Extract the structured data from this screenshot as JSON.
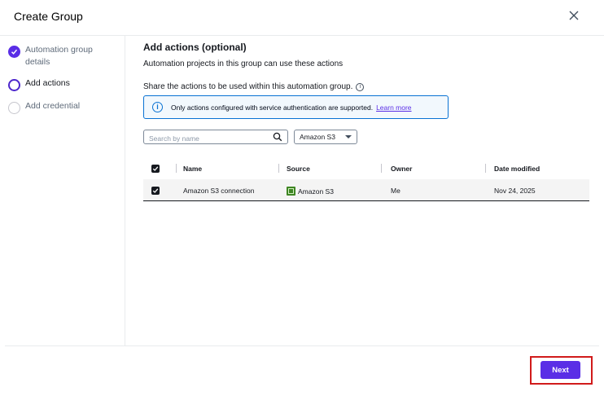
{
  "modal": {
    "title": "Create Group"
  },
  "steps": [
    {
      "label": "Automation group details",
      "state": "completed"
    },
    {
      "label": "Add actions",
      "state": "current"
    },
    {
      "label": "Add credential",
      "state": "pending"
    }
  ],
  "main": {
    "heading": "Add actions (optional)",
    "description": "Automation projects in this group can use these actions",
    "share_text": "Share the actions to be used within this automation group.",
    "alert": {
      "message": "Only actions configured with service authentication are supported.",
      "link": "Learn more"
    },
    "search": {
      "placeholder": "Search by name",
      "value": ""
    },
    "filter": {
      "selected": "Amazon S3"
    },
    "table": {
      "columns": [
        "Name",
        "Source",
        "Owner",
        "Date modified"
      ],
      "rows": [
        {
          "checked": true,
          "name": "Amazon S3 connection",
          "source": "Amazon S3",
          "owner": "Me",
          "date_modified": "Nov 24, 2025"
        }
      ]
    }
  },
  "footer": {
    "next_label": "Next"
  },
  "colors": {
    "accent": "#5a2ee6",
    "info": "#0972d3",
    "highlight": "#d11b1b"
  }
}
